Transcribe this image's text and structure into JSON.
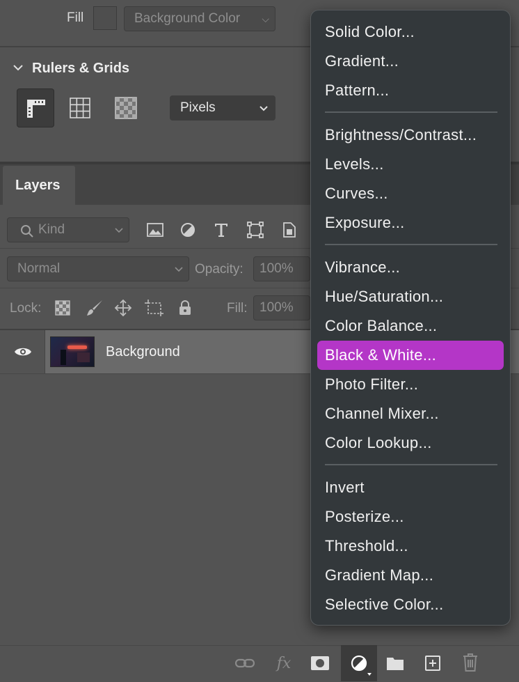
{
  "properties": {
    "fill_label": "Fill",
    "fill_value": "Background Color",
    "rulers_title": "Rulers & Grids",
    "units_value": "Pixels"
  },
  "layers_panel": {
    "tab_label": "Layers",
    "filter_placeholder": "Kind",
    "blend_mode": "Normal",
    "opacity_label": "Opacity:",
    "opacity_value": "100%",
    "lock_label": "Lock:",
    "fill_label": "Fill:",
    "fill_value": "100%",
    "layers": [
      {
        "name": "Background",
        "visible": true
      }
    ]
  },
  "menu": {
    "highlight_color": "#b436c7",
    "groups": [
      [
        "Solid Color...",
        "Gradient...",
        "Pattern..."
      ],
      [
        "Brightness/Contrast...",
        "Levels...",
        "Curves...",
        "Exposure..."
      ],
      [
        "Vibrance...",
        "Hue/Saturation...",
        "Color Balance...",
        "Black & White...",
        "Photo Filter...",
        "Channel Mixer...",
        "Color Lookup..."
      ],
      [
        "Invert",
        "Posterize...",
        "Threshold...",
        "Gradient Map...",
        "Selective Color..."
      ]
    ],
    "selected": "Black & White..."
  },
  "bottom_toolbar": {
    "icons": [
      "link-icon",
      "fx-icon",
      "mask-icon",
      "adjustment-icon",
      "folder-icon",
      "new-layer-icon",
      "trash-icon"
    ],
    "fx_text": "fx"
  }
}
